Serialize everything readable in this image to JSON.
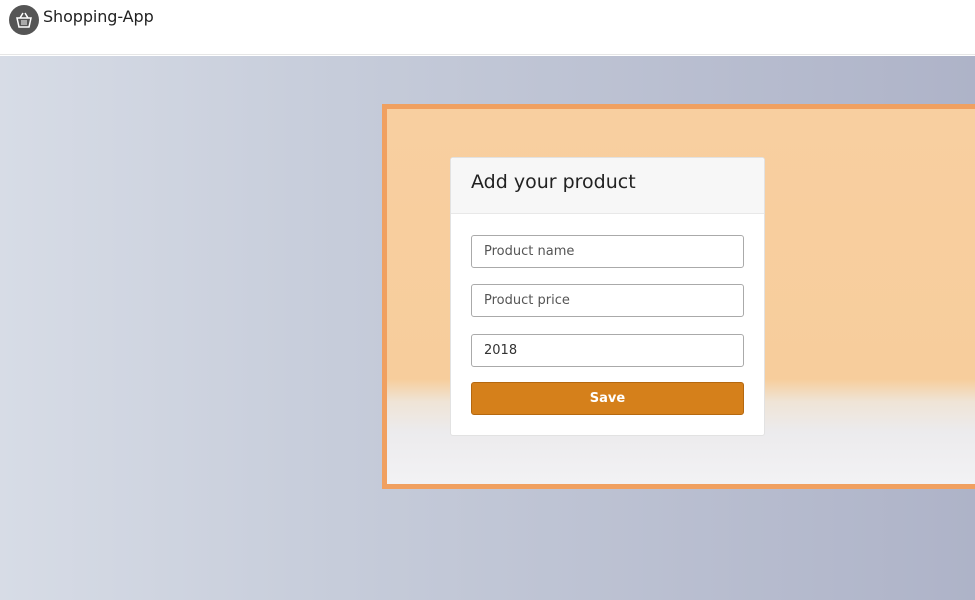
{
  "navbar": {
    "brand": "Shopping-App",
    "logo_icon": "basket-icon"
  },
  "form": {
    "title": "Add your product",
    "product_name_placeholder": "Product name",
    "product_price_placeholder": "Product price",
    "year_value": "2018",
    "save_label": "Save"
  },
  "colors": {
    "accent": "#d5801b",
    "hero_border": "#f0a060",
    "hero_background": "#f8cfa0"
  }
}
